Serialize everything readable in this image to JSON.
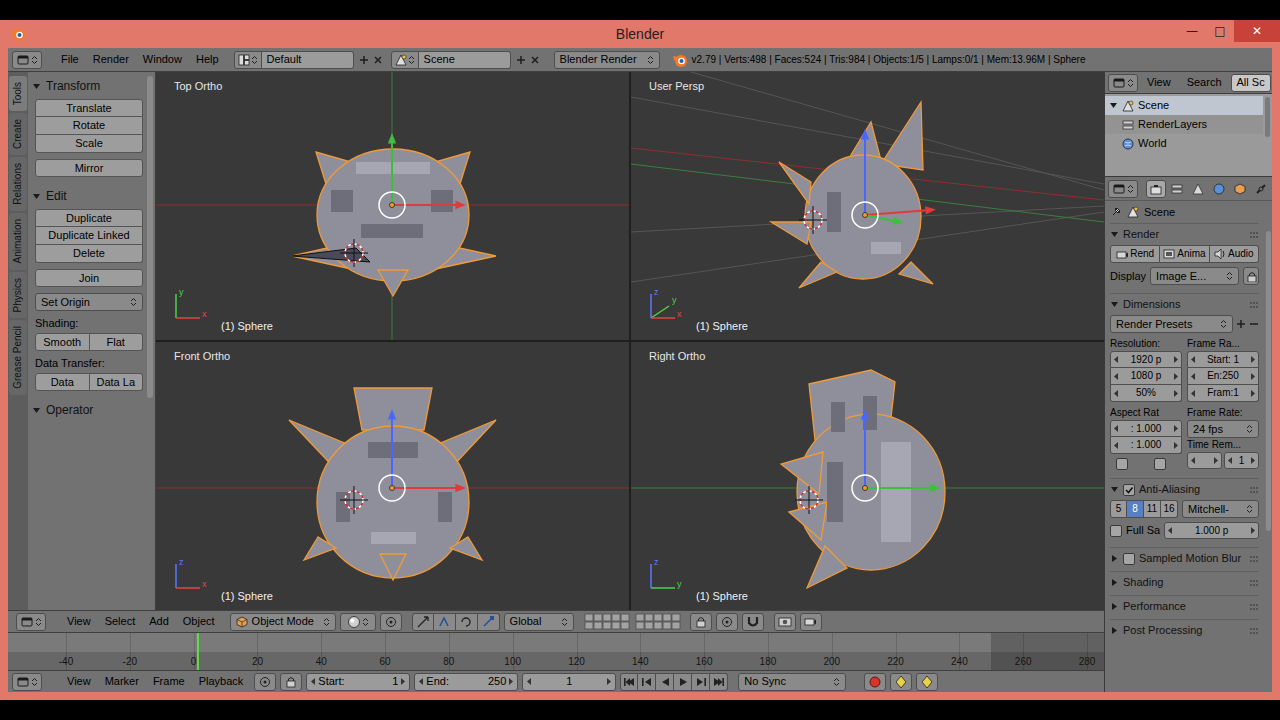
{
  "window": {
    "title": "Blender",
    "controls": [
      {
        "label": "—",
        "kind": "minimize"
      },
      {
        "label": "□",
        "kind": "maximize"
      },
      {
        "label": "✕",
        "kind": "close"
      }
    ]
  },
  "info_header": {
    "menus": [
      "File",
      "Render",
      "Window",
      "Help"
    ],
    "layout": "Default",
    "scene": "Scene",
    "engine": "Blender Render",
    "stats": "v2.79 | Verts:498 | Faces:524 | Tris:984 | Objects:1/5 | Lamps:0/1 | Mem:13.96M | Sphere"
  },
  "tool_shelf": {
    "tabs": [
      {
        "label": "Tools",
        "selected": true
      },
      {
        "label": "Create",
        "selected": false
      },
      {
        "label": "Relations",
        "selected": false
      },
      {
        "label": "Animation",
        "selected": false
      },
      {
        "label": "Physics",
        "selected": false
      },
      {
        "label": "Grease Pencil",
        "selected": false
      }
    ],
    "panels": [
      {
        "title": "Transform",
        "expanded": true,
        "rows": [
          {
            "kind": "stack",
            "items": [
              "Translate",
              "Rotate",
              "Scale"
            ]
          },
          {
            "kind": "stack",
            "items": [
              "Mirror"
            ]
          }
        ]
      },
      {
        "title": "Edit",
        "expanded": true,
        "rows": [
          {
            "kind": "stack",
            "items": [
              "Duplicate",
              "Duplicate Linked",
              "Delete"
            ]
          },
          {
            "kind": "stack",
            "items": [
              "Join"
            ]
          },
          {
            "kind": "dropdown",
            "items": [
              "Set Origin"
            ]
          },
          {
            "kind": "label",
            "items": [
              "Shading:"
            ]
          },
          {
            "kind": "pair",
            "items": [
              "Smooth",
              "Flat"
            ]
          },
          {
            "kind": "label",
            "items": [
              "Data Transfer:"
            ]
          },
          {
            "kind": "pair",
            "items": [
              "Data",
              "Data La"
            ]
          }
        ]
      },
      {
        "title": "Operator",
        "expanded": true,
        "rows": []
      }
    ]
  },
  "viewports": [
    {
      "label": "Top Ortho",
      "object": "(1) Sphere",
      "kind": "top",
      "axes": [
        {
          "label": "y",
          "color": "#4cd14c",
          "kind": "up"
        },
        {
          "label": "x",
          "color": "#e04545",
          "kind": "right"
        }
      ]
    },
    {
      "label": "User Persp",
      "object": "(1) Sphere",
      "kind": "persp",
      "axes": [
        {
          "label": "z",
          "color": "#5a78ff",
          "kind": "up"
        },
        {
          "label": "y",
          "color": "#4cd14c",
          "kind": "diag"
        },
        {
          "label": "x",
          "color": "#e04545",
          "kind": "right"
        }
      ]
    },
    {
      "label": "Front Ortho",
      "object": "(1) Sphere",
      "kind": "front",
      "axes": [
        {
          "label": "z",
          "color": "#5a78ff",
          "kind": "up"
        },
        {
          "label": "x",
          "color": "#e04545",
          "kind": "right"
        }
      ]
    },
    {
      "label": "Right Ortho",
      "object": "(1) Sphere",
      "kind": "right",
      "axes": [
        {
          "label": "z",
          "color": "#5a78ff",
          "kind": "up"
        },
        {
          "label": "y",
          "color": "#4cd14c",
          "kind": "right"
        }
      ]
    }
  ],
  "view3d_header": {
    "menus": [
      "View",
      "Select",
      "Add",
      "Object"
    ],
    "mode": "Object Mode",
    "orientation": "Global"
  },
  "timeline": {
    "ticks": [
      "-40",
      "-20",
      "0",
      "20",
      "40",
      "60",
      "80",
      "100",
      "120",
      "140",
      "160",
      "180",
      "200",
      "220",
      "240",
      "260",
      "280"
    ]
  },
  "timeline_header": {
    "menus": [
      "View",
      "Marker",
      "Frame",
      "Playback"
    ],
    "start": {
      "label": "Start:",
      "value": "1"
    },
    "end": {
      "label": "End:",
      "value": "250"
    },
    "current": "1",
    "sync": "No Sync"
  },
  "outliner": {
    "menus": [
      "View",
      "Search"
    ],
    "filter": "All Sc",
    "tree": [
      {
        "label": "Scene",
        "selected": true,
        "expanded": true,
        "children": [
          {
            "label": "RenderLayers",
            "selected": false
          },
          {
            "label": "World",
            "selected": false
          }
        ]
      }
    ]
  },
  "properties": {
    "tabs": [
      {
        "selected": true
      },
      {
        "selected": false
      },
      {
        "selected": false
      },
      {
        "selected": false
      },
      {
        "selected": false
      },
      {
        "selected": false
      }
    ],
    "breadcrumb": "Scene",
    "panels": [
      {
        "kind": "render",
        "title": "Render",
        "expanded": true,
        "buttons": [
          "Rend",
          "Anima",
          "Audio"
        ],
        "display_label": "Display",
        "display_value": "Image E..."
      },
      {
        "kind": "dimensions",
        "title": "Dimensions",
        "expanded": true,
        "presets": "Render Presets",
        "resolution": {
          "label": "Resolution:",
          "fields": [
            "1920 p",
            "1080 p",
            "50%"
          ]
        },
        "frame_range": {
          "label": "Frame Ra...",
          "fields": [
            "Start: 1",
            "En:250",
            "Fram:1"
          ]
        },
        "aspect": {
          "label": "Aspect Rat",
          "fields": [
            ": 1.000",
            ": 1.000"
          ],
          "toggles": [
            {
              "checked": false
            },
            {
              "checked": false
            }
          ]
        },
        "frame_rate": {
          "label": "Frame Rate:",
          "value": "24 fps"
        },
        "time_remap": {
          "label": "Time Rem...",
          "value": "1"
        }
      },
      {
        "kind": "antialiasing",
        "title": "Anti-Aliasing",
        "expanded": true,
        "checked": true,
        "samples": [
          {
            "label": "5",
            "selected": false
          },
          {
            "label": "8",
            "selected": true
          },
          {
            "label": "11",
            "selected": false
          },
          {
            "label": "16",
            "selected": false
          }
        ],
        "filter": "Mitchell-",
        "full_sample": {
          "label": "Full Sa",
          "checked": false
        },
        "size": "1.000 p"
      },
      {
        "kind": "collapsed",
        "title": "Sampled Motion Blur",
        "expanded": false,
        "checked": false
      },
      {
        "kind": "collapsed",
        "title": "Shading",
        "expanded": false
      },
      {
        "kind": "collapsed",
        "title": "Performance",
        "expanded": false
      },
      {
        "kind": "collapsed",
        "title": "Post Processing",
        "expanded": false
      }
    ]
  }
}
